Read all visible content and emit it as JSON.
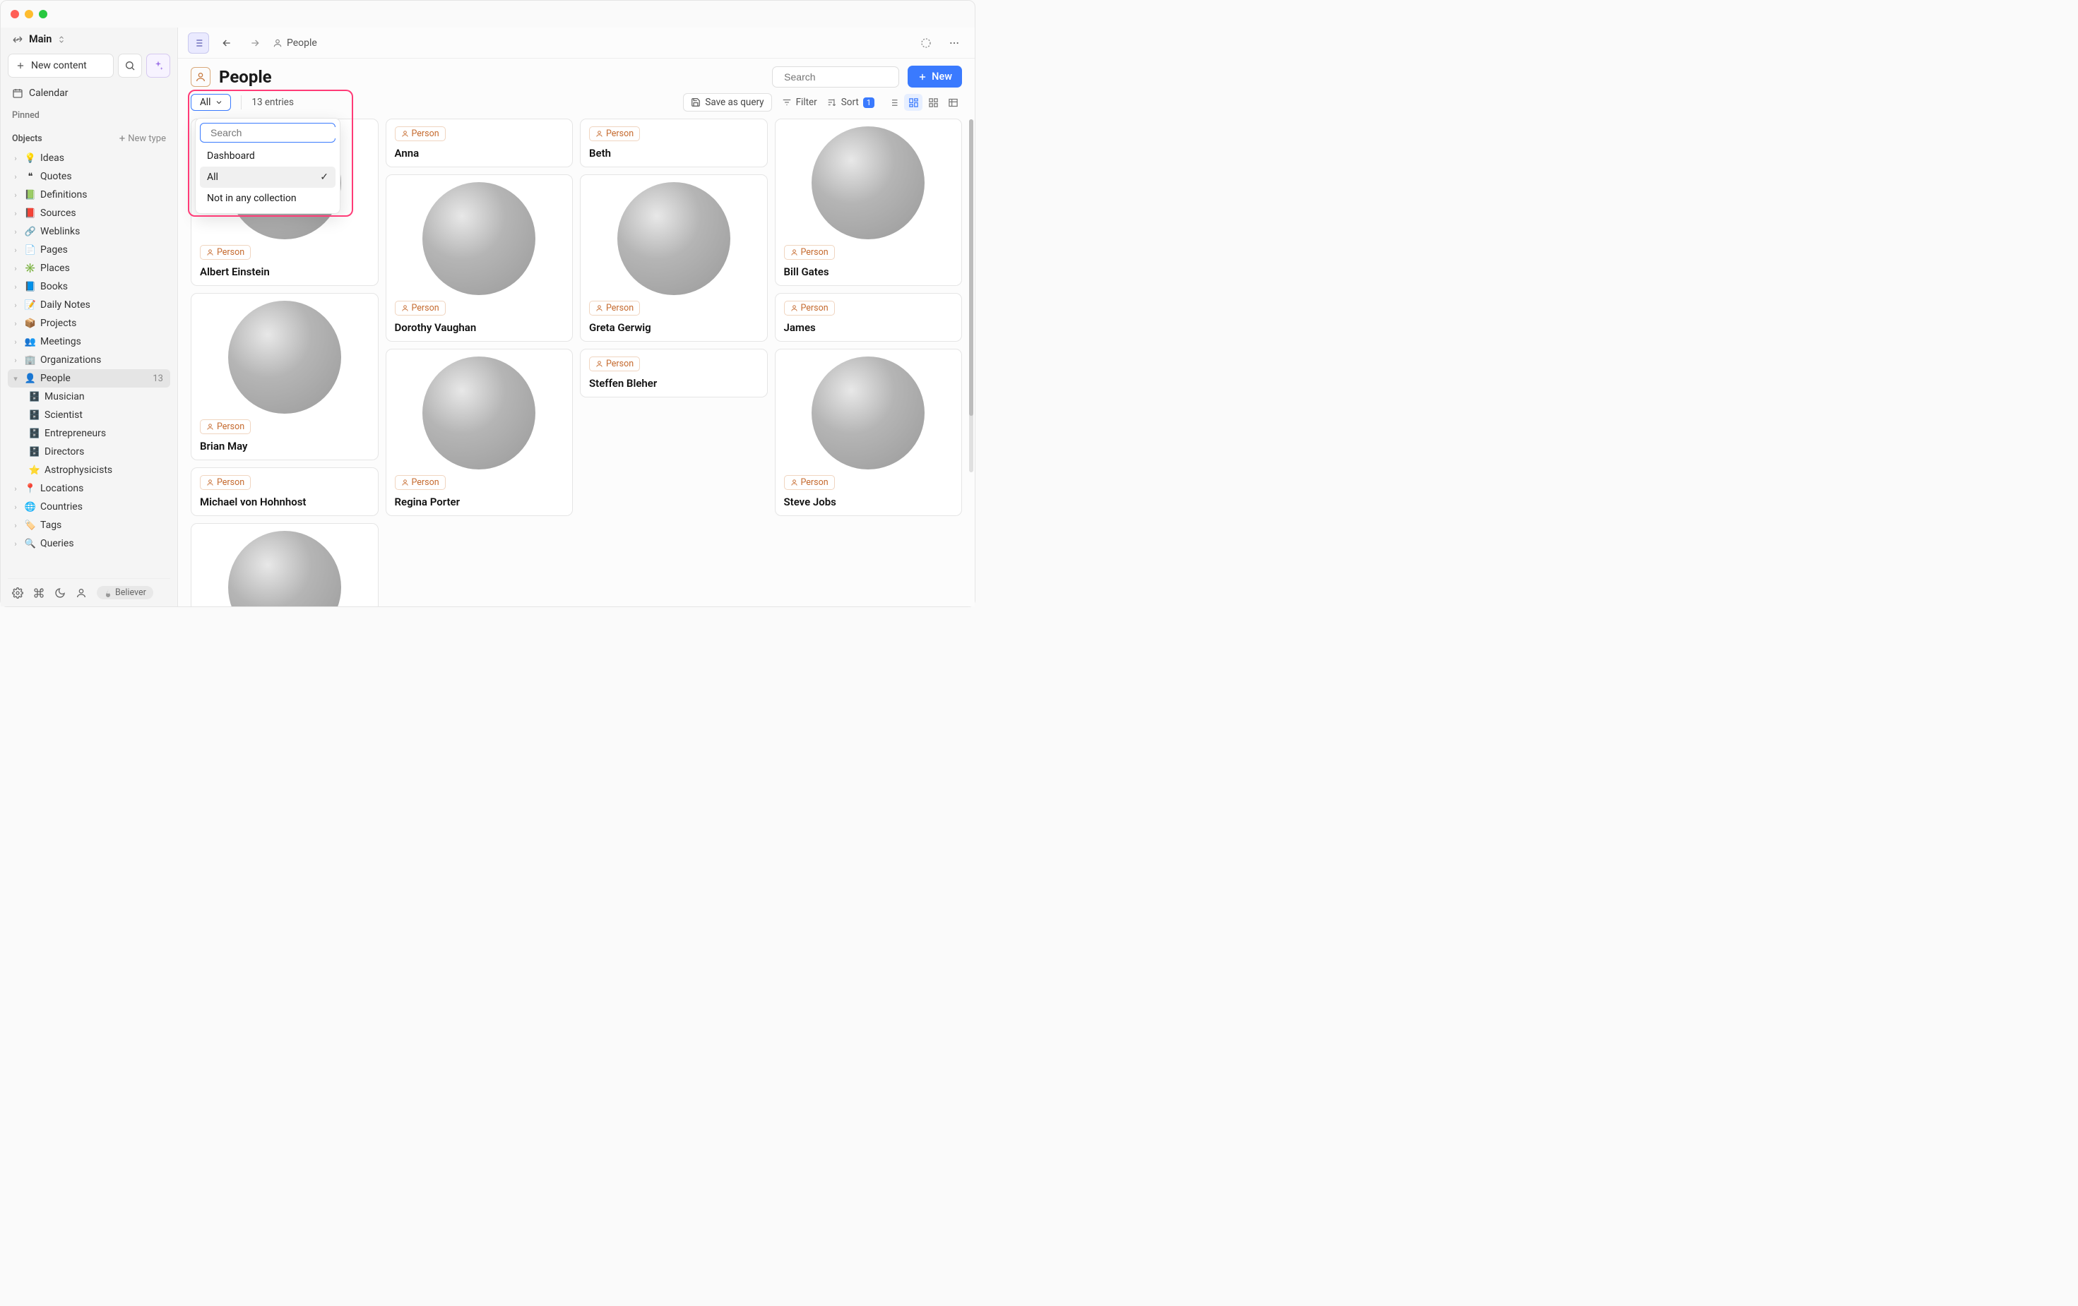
{
  "space": {
    "name": "Main"
  },
  "sidebar": {
    "new_content_label": "New content",
    "calendar_label": "Calendar",
    "pinned_label": "Pinned",
    "objects_label": "Objects",
    "new_type_label": "New type",
    "types": [
      {
        "label": "Ideas",
        "icon": "💡",
        "expanded": false
      },
      {
        "label": "Quotes",
        "icon": "❝",
        "expanded": false
      },
      {
        "label": "Definitions",
        "icon": "📗",
        "expanded": false
      },
      {
        "label": "Sources",
        "icon": "📕",
        "expanded": false
      },
      {
        "label": "Weblinks",
        "icon": "🔗",
        "expanded": false
      },
      {
        "label": "Pages",
        "icon": "📄",
        "expanded": false
      },
      {
        "label": "Places",
        "icon": "✳️",
        "expanded": false
      },
      {
        "label": "Books",
        "icon": "📘",
        "expanded": false
      },
      {
        "label": "Daily Notes",
        "icon": "📝",
        "expanded": false
      },
      {
        "label": "Projects",
        "icon": "📦",
        "expanded": false
      },
      {
        "label": "Meetings",
        "icon": "👥",
        "expanded": false
      },
      {
        "label": "Organizations",
        "icon": "🏢",
        "expanded": false
      },
      {
        "label": "People",
        "icon": "👤",
        "expanded": true,
        "selected": true,
        "count": "13",
        "children": [
          {
            "label": "Musician",
            "icon": "🗄️"
          },
          {
            "label": "Scientist",
            "icon": "🗄️"
          },
          {
            "label": "Entrepreneurs",
            "icon": "🗄️"
          },
          {
            "label": "Directors",
            "icon": "🗄️"
          },
          {
            "label": "Astrophysicists",
            "icon": "⭐"
          }
        ]
      },
      {
        "label": "Locations",
        "icon": "📍",
        "expanded": false
      },
      {
        "label": "Countries",
        "icon": "🌐",
        "expanded": false
      },
      {
        "label": "Tags",
        "icon": "🏷️",
        "expanded": false
      },
      {
        "label": "Queries",
        "icon": "🔍",
        "expanded": false
      }
    ],
    "footer_badge": "Believer"
  },
  "tabs": {
    "current_label": "People"
  },
  "page": {
    "title": "People",
    "search_placeholder": "Search",
    "new_button_label": "New"
  },
  "toolbar": {
    "filter_chip_label": "All",
    "entries_text": "13 entries",
    "save_query_label": "Save as query",
    "filter_label": "Filter",
    "sort_label": "Sort",
    "sort_count": "1"
  },
  "dropdown": {
    "search_placeholder": "Search",
    "items": [
      {
        "label": "Dashboard",
        "selected": false
      },
      {
        "label": "All",
        "selected": true
      },
      {
        "label": "Not in any collection",
        "selected": false
      }
    ]
  },
  "badge_label": "Person",
  "columns": [
    [
      {
        "title": "Albert Einstein",
        "has_image": true,
        "bw": true
      },
      {
        "title": "Brian May",
        "has_image": true,
        "bw": false
      },
      {
        "title": "Michael von Hohnhost",
        "has_image": false,
        "bw": false
      },
      {
        "title": "",
        "has_image": true,
        "bw": false,
        "partial": true
      }
    ],
    [
      {
        "title": "Anna",
        "has_image": false,
        "bw": false,
        "small": true
      },
      {
        "title": "Dorothy Vaughan",
        "has_image": true,
        "bw": true
      },
      {
        "title": "Regina Porter",
        "has_image": true,
        "bw": true
      }
    ],
    [
      {
        "title": "Beth",
        "has_image": false,
        "bw": false,
        "small": true
      },
      {
        "title": "Greta Gerwig",
        "has_image": true,
        "bw": false
      },
      {
        "title": "Steffen Bleher",
        "has_image": false,
        "bw": false,
        "small": true
      }
    ],
    [
      {
        "title": "Bill Gates",
        "has_image": true,
        "bw": false
      },
      {
        "title": "James",
        "has_image": false,
        "bw": false,
        "small": true
      },
      {
        "title": "Steve Jobs",
        "has_image": true,
        "bw": false
      }
    ]
  ]
}
